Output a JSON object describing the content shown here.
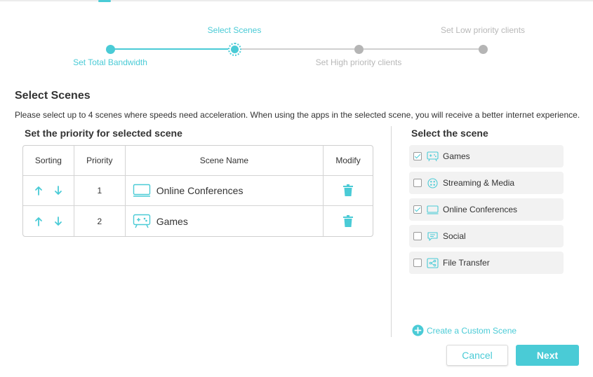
{
  "stepper": {
    "steps": [
      {
        "label": "Set Total Bandwidth",
        "state": "done"
      },
      {
        "label": "Select Scenes",
        "state": "current"
      },
      {
        "label": "Set High priority clients",
        "state": "pending"
      },
      {
        "label": "Set Low priority clients",
        "state": "pending"
      }
    ]
  },
  "page": {
    "title": "Select Scenes",
    "description": "Please select up to 4 scenes where speeds need acceleration. When using the apps in the selected scene, you will receive a better internet experience."
  },
  "priority": {
    "title": "Set the priority for selected scene",
    "columns": [
      "Sorting",
      "Priority",
      "Scene Name",
      "Modify"
    ],
    "rows": [
      {
        "priority": "1",
        "name": "Online Conferences",
        "icon": "monitor-icon"
      },
      {
        "priority": "2",
        "name": "Games",
        "icon": "gamepad-icon"
      }
    ]
  },
  "scenes": {
    "title": "Select the scene",
    "items": [
      {
        "label": "Games",
        "checked": true,
        "icon": "gamepad-icon"
      },
      {
        "label": "Streaming & Media",
        "checked": false,
        "icon": "streaming-icon"
      },
      {
        "label": "Online Conferences",
        "checked": true,
        "icon": "monitor-icon"
      },
      {
        "label": "Social",
        "checked": false,
        "icon": "chat-icon"
      },
      {
        "label": "File Transfer",
        "checked": false,
        "icon": "share-icon"
      }
    ],
    "custom_label": "Create a Custom Scene"
  },
  "buttons": {
    "cancel": "Cancel",
    "next": "Next"
  },
  "colors": {
    "accent": "#4acbd6",
    "pending": "#b5b5b5"
  }
}
